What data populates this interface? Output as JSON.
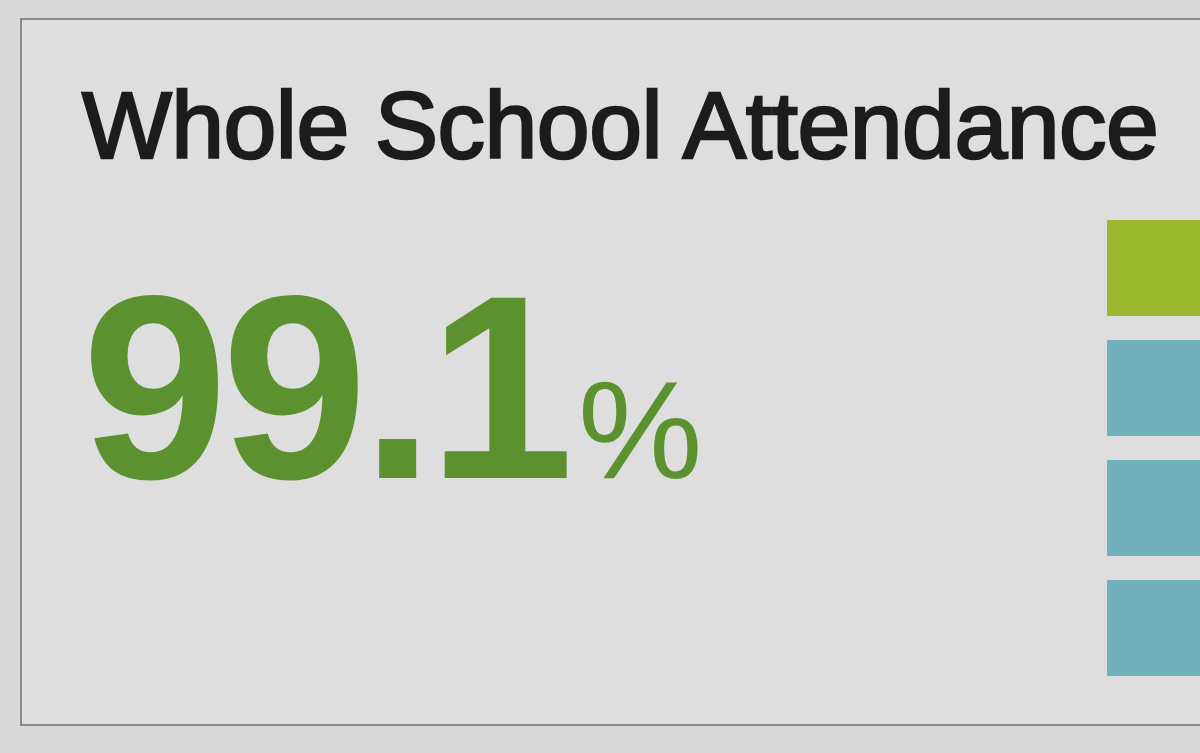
{
  "card": {
    "title": "Whole School Attendance",
    "value": "99.1",
    "unit": "%"
  },
  "tiles": [
    {
      "color": "#9cb82c"
    },
    {
      "color": "#6fb0bb"
    },
    {
      "color": "#6fb0bb"
    },
    {
      "color": "#6fb0bb"
    }
  ]
}
